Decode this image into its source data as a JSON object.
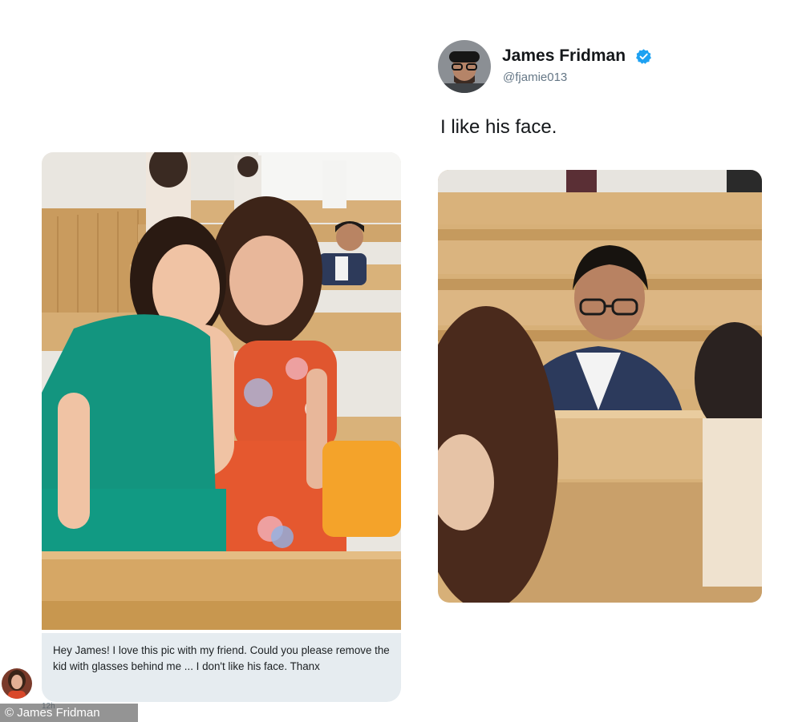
{
  "dm": {
    "message": "Hey James! I love this pic with my friend. Could you please remove the kid with glasses behind me  ... I don't like his face. Thanx",
    "time": "12h",
    "original_photo_icon": "church-pew-photo",
    "sender_avatar_icon": "sender-avatar"
  },
  "tweet": {
    "author_name": "James Fridman",
    "author_handle": "@fjamie013",
    "verified_icon": "verified-badge-icon",
    "text": "I like his face.",
    "edited_photo_icon": "edited-photo"
  },
  "watermark": "© James Fridman",
  "colors": {
    "bubble_bg": "#e6ecf0",
    "verified_blue": "#1da1f2",
    "pew_wood": "#d9b27a"
  }
}
